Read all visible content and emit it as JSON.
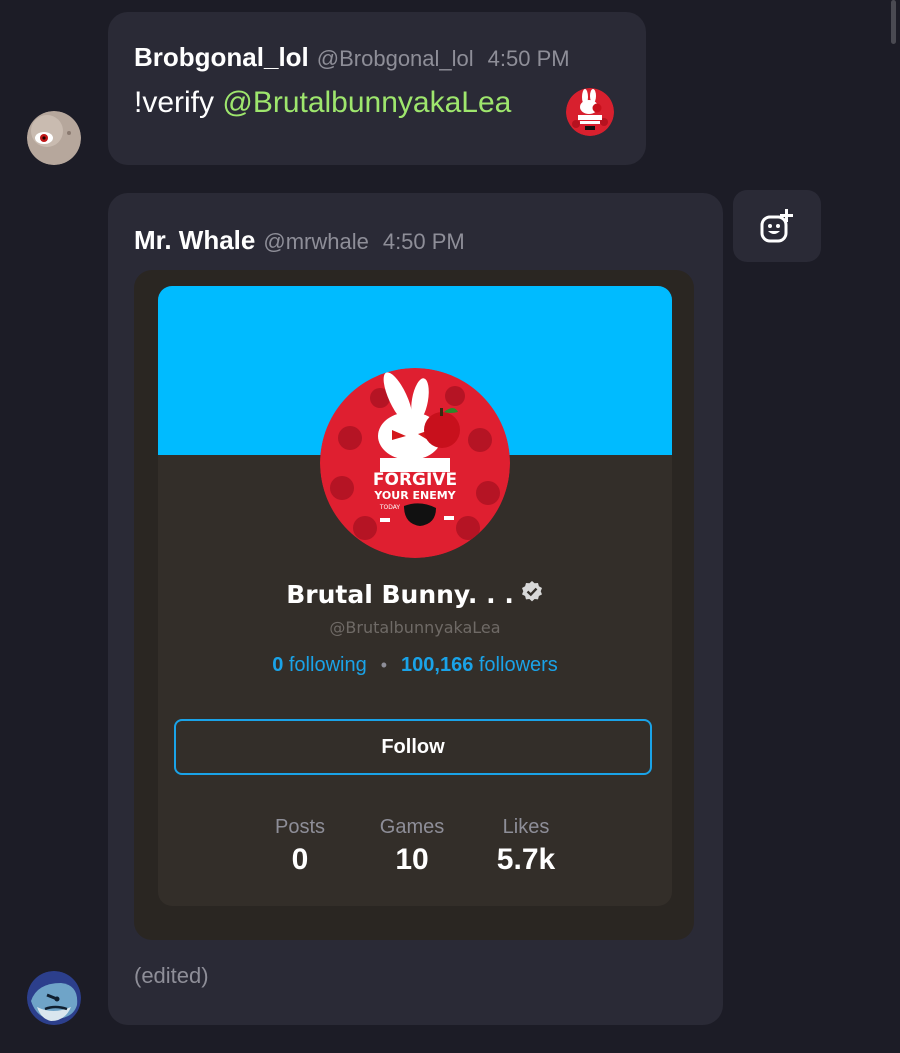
{
  "messages": [
    {
      "display_name": "Brobgonal_lol",
      "handle": "@Brobgonal_lol",
      "time": "4:50 PM",
      "command": "!verify",
      "mention": "@BrutalbunnyakaLea"
    },
    {
      "display_name": "Mr. Whale",
      "handle": "@mrwhale",
      "time": "4:50 PM",
      "edited_label": "(edited)",
      "embed": {
        "name": "Brutal Bunny. . .",
        "handle": "@BrutalbunnyakaLea",
        "following_count": "0",
        "following_label": "following",
        "followers_count": "100,166",
        "followers_label": "followers",
        "follow_button": "Follow",
        "stats": [
          {
            "label": "Posts",
            "value": "0"
          },
          {
            "label": "Games",
            "value": "10"
          },
          {
            "label": "Likes",
            "value": "5.7k"
          }
        ],
        "avatar_text": {
          "line1": "FORGIVE",
          "line2": "YOUR ENEMY",
          "line3": "TODAY"
        }
      }
    }
  ],
  "colors": {
    "background": "#1c1c26",
    "bubble": "#2a2a36",
    "mention": "#9ee66d",
    "accent_blue": "#1aa3e8",
    "banner": "#00bbff"
  },
  "icons": [
    "add-reaction-icon",
    "verified-icon"
  ]
}
